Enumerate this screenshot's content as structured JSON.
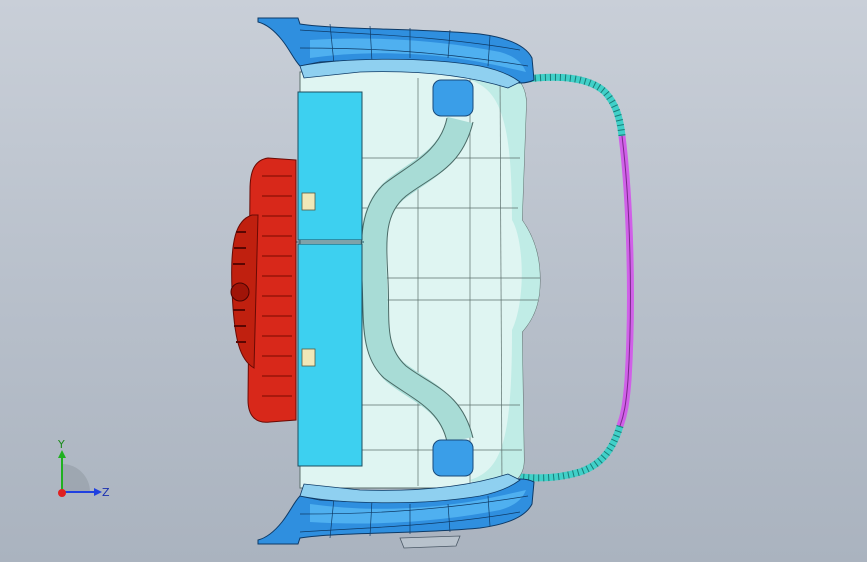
{
  "viewport": {
    "background_top": "#c9cfd8",
    "background_bottom": "#aab3bf"
  },
  "model": {
    "parts": [
      "blue-body-shell",
      "cyan-inner-panel",
      "cyan-rear-panels",
      "red-rear-component",
      "pink-rail",
      "teal-rail"
    ],
    "colors": {
      "blue_shell": "#2f8fdf",
      "blue_shell_light": "#4fb0f0",
      "inner_panel": "#dff5f2",
      "inner_panel_shade": "#c0ece6",
      "rear_panel": "#3dd0f0",
      "red_part": "#d8281a",
      "red_part_dark": "#a01408",
      "pink_rail": "#d060e8",
      "teal_rail": "#40d0c8",
      "tag": "#f0e8b8"
    }
  },
  "triad": {
    "y_label": "Y",
    "z_label": "Z",
    "y_color": "#20b020",
    "z_color": "#2040e0",
    "x_color": "#e02020"
  }
}
